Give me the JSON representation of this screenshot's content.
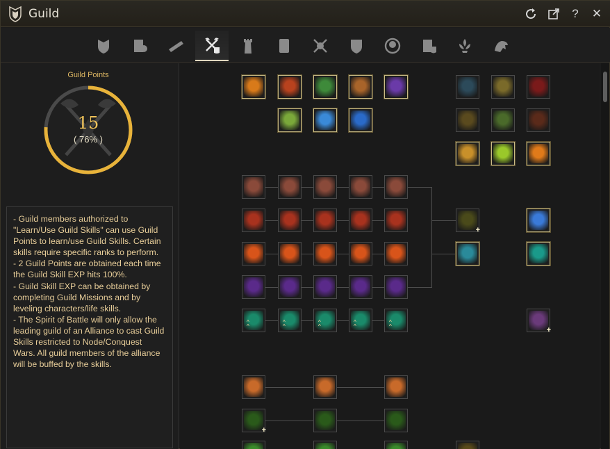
{
  "window": {
    "title": "Guild"
  },
  "titlebar_buttons": [
    {
      "name": "refresh-icon",
      "glyph": "⟳"
    },
    {
      "name": "popout-icon",
      "glyph": "⧉"
    },
    {
      "name": "help-icon",
      "glyph": "?"
    },
    {
      "name": "close-icon",
      "glyph": "✕"
    }
  ],
  "tabs": [
    {
      "name": "tab-guild-info",
      "icon": "shield-crest-icon",
      "active": false
    },
    {
      "name": "tab-guild-members",
      "icon": "member-scroll-icon",
      "active": false
    },
    {
      "name": "tab-guild-quests",
      "icon": "telescope-icon",
      "active": false
    },
    {
      "name": "tab-guild-skills",
      "icon": "crossed-axes-icon",
      "active": true
    },
    {
      "name": "tab-guild-territory",
      "icon": "tower-icon",
      "active": false
    },
    {
      "name": "tab-guild-contract",
      "icon": "contract-icon",
      "active": false
    },
    {
      "name": "tab-guild-war",
      "icon": "crossed-swords-icon",
      "active": false
    },
    {
      "name": "tab-guild-alliance",
      "icon": "alliance-shield-icon",
      "active": false
    },
    {
      "name": "tab-guild-emblem",
      "icon": "emblem-circle-icon",
      "active": false
    },
    {
      "name": "tab-guild-records",
      "icon": "records-scroll-icon",
      "active": false
    },
    {
      "name": "tab-guild-banner",
      "icon": "fleur-icon",
      "active": false
    },
    {
      "name": "tab-guild-mount",
      "icon": "mount-icon",
      "active": false
    }
  ],
  "guild_points": {
    "label": "Guild Points",
    "value": "15",
    "percent_text": "( 76% )",
    "progress": 0.76,
    "ring_color": "#e8b33a"
  },
  "description": [
    "- Guild members authorized to \"Learn/Use Guild Skills\" can use Guild Points to learn/use Guild Skills. Certain skills require specific ranks to perform.",
    "- 2 Guild Points are obtained each time the Guild Skill EXP hits 100%.",
    "- Guild Skill EXP can be obtained by completing Guild Missions and by leveling characters/life skills.",
    "- The Spirit of Battle will only allow the leading guild of an Alliance to cast Guild Skills restricted to Node/Conquest Wars. All guild members of the alliance will be buffed by the skills."
  ],
  "skill_groups": {
    "top_left_row1": [
      {
        "name": "skill-flame-shield",
        "color": "#d87a1a",
        "learned": true
      },
      {
        "name": "skill-fire-armor",
        "color": "#b8421e",
        "learned": true
      },
      {
        "name": "skill-green-warrior",
        "color": "#3e8a3a",
        "learned": true
      },
      {
        "name": "skill-crossed-blades",
        "color": "#a8642a",
        "learned": true
      },
      {
        "name": "skill-purple-orb",
        "color": "#6a3aa8",
        "learned": true
      }
    ],
    "top_left_row2": [
      {
        "name": "skill-green-slash",
        "color": "#7aa83a",
        "learned": true
      },
      {
        "name": "skill-blue-spirit",
        "color": "#3a8ad8",
        "learned": true
      },
      {
        "name": "skill-blue-wave",
        "color": "#2a6ac8",
        "learned": true
      }
    ],
    "top_right": [
      {
        "name": "skill-dark-helm",
        "color": "#2c4a5a",
        "learned": false
      },
      {
        "name": "skill-gold-crest",
        "color": "#7a6a2a",
        "learned": false
      },
      {
        "name": "skill-red-slash",
        "color": "#7a1a1a",
        "learned": false
      },
      {
        "name": "skill-dim-forge",
        "color": "#5a4a1e",
        "learned": false
      },
      {
        "name": "skill-clover",
        "color": "#4a6a2a",
        "learned": false
      },
      {
        "name": "skill-dark-beast",
        "color": "#5a2a1a",
        "learned": false
      },
      {
        "name": "skill-golden-hand",
        "color": "#c8902a",
        "learned": true
      },
      {
        "name": "skill-lime-sigil",
        "color": "#9ac82a",
        "learned": true
      },
      {
        "name": "skill-flame-burst",
        "color": "#e07a1a",
        "learned": true
      }
    ],
    "tier_rows": [
      {
        "name": "tier-row-helm",
        "color": "#8a4a3a"
      },
      {
        "name": "tier-row-sword",
        "color": "#a8321e"
      },
      {
        "name": "tier-row-fire",
        "color": "#d8541a"
      },
      {
        "name": "tier-row-spiral",
        "color": "#5a2a8a"
      },
      {
        "name": "tier-row-teal-slash",
        "color": "#1a8a6a"
      }
    ],
    "tier_row_flags": [
      "",
      "",
      "",
      "",
      "up"
    ],
    "branch_nodes": [
      {
        "name": "skill-branch-dark",
        "color": "#4a4a1a",
        "learned": false,
        "plus": true
      },
      {
        "name": "skill-branch-teal-monster",
        "color": "#2a8a9a",
        "learned": true,
        "plus": false
      }
    ],
    "right_col": [
      {
        "name": "skill-blue-shield-slash",
        "color": "#3a7ad8",
        "learned": true
      },
      {
        "name": "skill-teal-rage",
        "color": "#1a9a8a",
        "learned": true
      },
      {
        "name": "skill-purple-beast",
        "color": "#6a3a7a",
        "learned": false
      }
    ],
    "bottom_rows": [
      {
        "name": "bottom-row-torch",
        "color": "#c86a2a"
      },
      {
        "name": "bottom-row-green-shadow",
        "color": "#2a5a1a"
      },
      {
        "name": "bottom-row-green-leaf",
        "color": "#3a8a2a"
      }
    ]
  }
}
